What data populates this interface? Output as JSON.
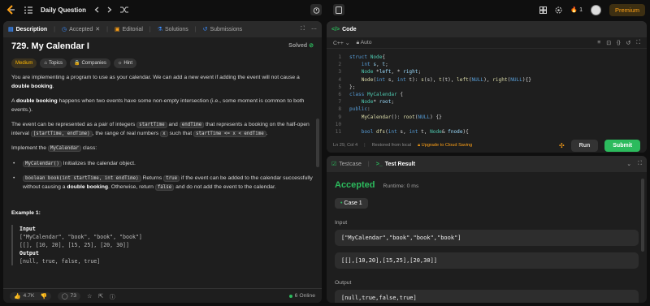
{
  "topbar": {
    "title": "Daily Question",
    "streak": "1",
    "premium": "Premium"
  },
  "desc_tabs": [
    {
      "label": "Description"
    },
    {
      "label": "Accepted"
    },
    {
      "label": "Editorial"
    },
    {
      "label": "Solutions"
    },
    {
      "label": "Submissions"
    }
  ],
  "problem": {
    "title": "729. My Calendar I",
    "solved": "Solved",
    "chips": {
      "difficulty": "Medium",
      "topics": "Topics",
      "companies": "Companies",
      "hint": "Hint"
    },
    "p1a": "You are implementing a program to use as your calendar. We can add a new event if adding the event will not cause a ",
    "p1b": "double booking",
    "p1c": ".",
    "p2a": "A ",
    "p2b": "double booking",
    "p2c": " happens when two events have some non-empty intersection (i.e., some moment is common to both events.).",
    "p3a": "The event can be represented as a pair of integers ",
    "p3code1": "startTime",
    "p3b": " and ",
    "p3code2": "endTime",
    "p3c": " that represents a booking on the half-open interval ",
    "p3code3": "[startTime, endTime)",
    "p3d": ", the range of real numbers ",
    "p3code4": "x",
    "p3e": " such that ",
    "p3code5": "startTime <= x < endTime",
    "p3f": ".",
    "p4a": "Implement the ",
    "p4code": "MyCalendar",
    "p4b": " class:",
    "li1code": "MyCalendar()",
    "li1": " Initializes the calendar object.",
    "li2code1": "boolean book(int startTime, int endTime)",
    "li2a": " Returns ",
    "li2code2": "true",
    "li2b": " if the event can be added to the calendar successfully without causing a ",
    "li2c": "double booking",
    "li2d": ". Otherwise, return ",
    "li2code3": "false",
    "li2e": " and do not add the event to the calendar.",
    "example_title": "Example 1:",
    "ex_input_label": "Input",
    "ex_in1": "[\"MyCalendar\", \"book\", \"book\", \"book\"]",
    "ex_in2": "[[], [10, 20], [15, 25], [20, 30]]",
    "ex_output_label": "Output",
    "ex_out": "[null, true, false, true]"
  },
  "footer": {
    "likes": "4.7K",
    "comments": "73",
    "online": "6 Online"
  },
  "code": {
    "tab": "Code",
    "lang": "C++",
    "mode": "Auto",
    "line_numbers": [
      "1",
      "2",
      "3",
      "4",
      "5",
      "6",
      "7",
      "8",
      "9",
      "10",
      "11"
    ],
    "status": "Ln 29, Col 4",
    "saved": "Restored from local",
    "upgrade": "Upgrade to Cloud Saving",
    "run": "Run",
    "submit": "Submit"
  },
  "result": {
    "tab_testcase": "Testcase",
    "tab_result": "Test Result",
    "status": "Accepted",
    "runtime": "Runtime: 0 ms",
    "case": "Case 1",
    "input_label": "Input",
    "input1": "[\"MyCalendar\",\"book\",\"book\",\"book\"]",
    "input2": "[[],[10,20],[15,25],[20,30]]",
    "output_label": "Output",
    "output": "[null,true,false,true]"
  },
  "colors": {
    "accent": "#ffa116",
    "green": "#2cbb5d",
    "bg": "#0f0f0f",
    "panel": "#1e1e1e"
  }
}
